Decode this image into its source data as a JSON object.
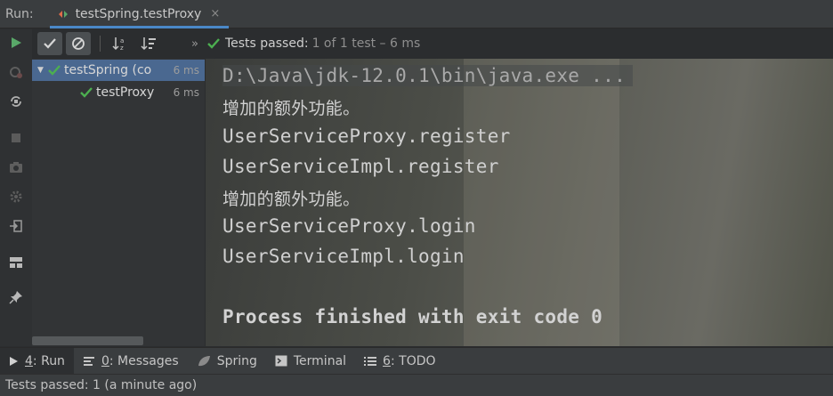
{
  "run_panel": {
    "label": "Run:",
    "tab_title": "testSpring.testProxy",
    "tab_close": "×"
  },
  "test_toolbar": {
    "more": "»",
    "passed_label": "Tests passed:",
    "passed_count": "1 of 1 test – 6 ms"
  },
  "test_tree": {
    "items": [
      {
        "name": "testSpring (co",
        "time": "6 ms",
        "status": "passed",
        "expanded": true
      },
      {
        "name": "testProxy",
        "time": "6 ms",
        "status": "passed"
      }
    ]
  },
  "console": {
    "lines": [
      "D:\\Java\\jdk-12.0.1\\bin\\java.exe ...",
      "增加的额外功能。",
      "UserServiceProxy.register",
      "UserServiceImpl.register",
      "增加的额外功能。",
      "UserServiceProxy.login",
      "UserServiceImpl.login",
      "",
      "Process finished with exit code 0"
    ]
  },
  "bottom_tools": {
    "run": {
      "num": "4",
      "rest": ": Run"
    },
    "messages": {
      "num": "0",
      "rest": ": Messages"
    },
    "spring": "Spring",
    "terminal": "Terminal",
    "todo": {
      "num": "6",
      "rest": ": TODO"
    }
  },
  "status_bar": {
    "text": "Tests passed: 1 (a minute ago)"
  },
  "colors": {
    "pass_green": "#4caf50",
    "run_green": "#59a869",
    "selection_blue": "#4a6890",
    "tab_underline": "#4a88c7"
  }
}
